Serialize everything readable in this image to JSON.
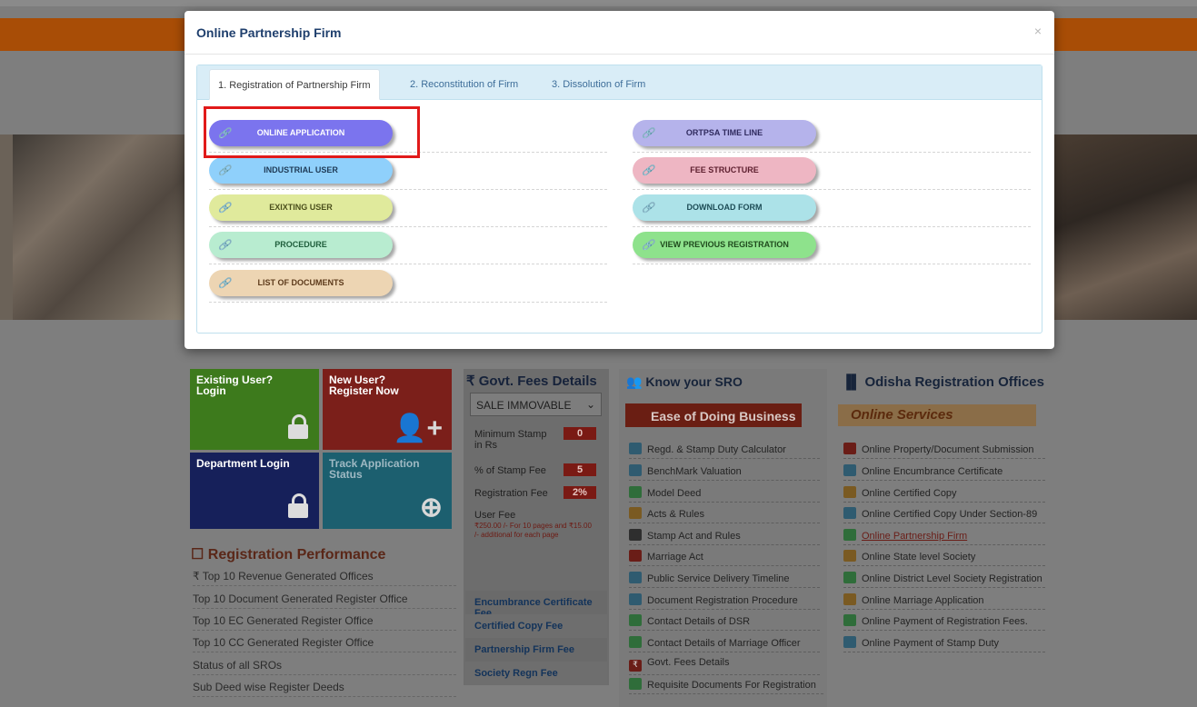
{
  "modal": {
    "title": "Online Partnership Firm",
    "close_label": "×",
    "tabs": [
      {
        "label": "1. Registration of Partnership Firm"
      },
      {
        "label": "2. Reconstitution of Firm"
      },
      {
        "label": "3. Dissolution of Firm"
      }
    ],
    "left_buttons": [
      {
        "label": "ONLINE APPLICATION",
        "color": "#7b74ee",
        "text_color": "#ffffff"
      },
      {
        "label": "INDUSTRIAL USER",
        "color": "#8fd0fb",
        "text_color": "#1f3b57"
      },
      {
        "label": "EXIXTING USER",
        "color": "#e0ea9c",
        "text_color": "#4b4f1c"
      },
      {
        "label": "PROCEDURE",
        "color": "#b8ecd0",
        "text_color": "#1f5e3c"
      },
      {
        "label": "LIST OF DOCUMENTS",
        "color": "#edd5b3",
        "text_color": "#5d3a1b"
      }
    ],
    "right_buttons": [
      {
        "label": "ORTPSA TIME LINE",
        "color": "#b5b3eb",
        "text_color": "#2f2a5e"
      },
      {
        "label": "FEE STRUCTURE",
        "color": "#eeb6c3",
        "text_color": "#5e2030"
      },
      {
        "label": "DOWNLOAD FORM",
        "color": "#ace2e8",
        "text_color": "#1d4c56"
      },
      {
        "label": "VIEW PREVIOUS REGISTRATION",
        "color": "#8ee28c",
        "text_color": "#1f4a1d"
      }
    ],
    "link_icon": "link-icon"
  },
  "tiles": {
    "existing_user": "Existing User?\nLogin",
    "new_user": "New User?\nRegister Now",
    "department_login": "Department Login",
    "track_status": "Track Application\nStatus"
  },
  "performance": {
    "title": "Registration Performance",
    "items": [
      "₹ Top 10 Revenue Generated Offices",
      "Top 10 Document Generated Register Office",
      "Top 10 EC Generated Register Office",
      "Top 10 CC Generated Register Office",
      "Status of all SROs",
      "Sub Deed wise Register Deeds"
    ]
  },
  "fees": {
    "title": "₹ Govt. Fees Details",
    "select_value": "SALE IMMOVABLE",
    "rows": [
      {
        "label": "Minimum Stamp in Rs",
        "value": "0"
      },
      {
        "label": "% of Stamp Fee",
        "value": "5"
      },
      {
        "label": "Registration Fee",
        "value": "2%"
      },
      {
        "label": "User Fee",
        "value": ""
      }
    ],
    "user_fee_note": "₹250.00 /- For 10 pages and ₹15.00 /- additional for each page",
    "links": [
      "Encumbrance Certificate Fee",
      "Certified Copy Fee",
      "Partnership Firm Fee",
      "Society Regn Fee"
    ]
  },
  "sro": {
    "title": "Know your SRO",
    "ease_label": "Ease of Doing Business",
    "items": [
      "Regd. & Stamp Duty Calculator",
      "BenchMark Valuation",
      "Model Deed",
      "Acts & Rules",
      "Stamp Act and Rules",
      "Marriage Act",
      "Public Service Delivery Timeline",
      "Document Registration Procedure",
      "Contact Details of DSR",
      "Contact Details of Marriage Officer",
      "Govt. Fees Details",
      "Requisite Documents For Registration"
    ]
  },
  "odisha": {
    "title": "Odisha Registration Offices",
    "online_services_label": "Online Services",
    "items": [
      "Online Property/Document Submission",
      "Online Encumbrance Certificate",
      "Online Certified Copy",
      "Online Certified Copy Under Section-89",
      "Online Partnership Firm",
      "Online State level Society",
      "Online District Level Society Registration",
      "Online Marriage Application",
      "Online Payment of Registration Fees.",
      "Online Payment of Stamp Duty"
    ]
  }
}
